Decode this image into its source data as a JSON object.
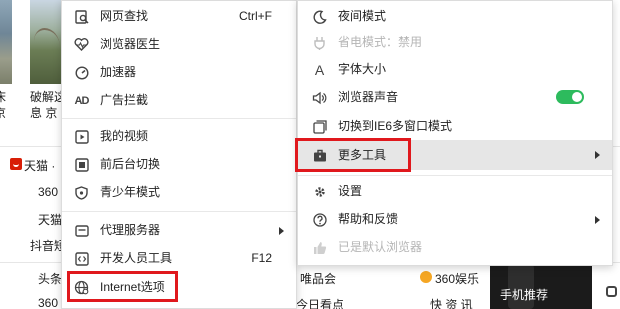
{
  "background": {
    "snippets": [
      {
        "text": "破解这"
      },
      {
        "text": "息 京"
      },
      {
        "text": "天猫 ·"
      },
      {
        "text": "360"
      },
      {
        "text": "天猫"
      },
      {
        "text": "抖音短"
      },
      {
        "text": "头条"
      },
      {
        "text": "360"
      },
      {
        "text": "唯品会"
      },
      {
        "text": "360娱乐"
      },
      {
        "text": "今日看点"
      },
      {
        "text": "快 资 讯"
      },
      {
        "text": "手机推荐"
      },
      {
        "text": "床"
      },
      {
        "text": "京"
      }
    ]
  },
  "left_menu": {
    "items": [
      {
        "label": "网页查找",
        "shortcut": "Ctrl+F",
        "icon": "find-page-icon"
      },
      {
        "label": "浏览器医生",
        "icon": "doctor-heart-icon"
      },
      {
        "label": "加速器",
        "icon": "speedometer-icon"
      },
      {
        "label": "广告拦截",
        "icon": "ad-block-icon"
      },
      {
        "label": "我的视频",
        "icon": "video-play-icon"
      },
      {
        "label": "前后台切换",
        "icon": "switch-window-icon"
      },
      {
        "label": "青少年模式",
        "icon": "shield-icon"
      },
      {
        "label": "代理服务器",
        "icon": "proxy-icon"
      },
      {
        "label": "开发人员工具",
        "shortcut": "F12",
        "icon": "code-icon"
      },
      {
        "label": "Internet选项",
        "icon": "internet-globe-icon"
      }
    ]
  },
  "right_menu": {
    "items": [
      {
        "label": "夜间模式",
        "icon": "moon-icon"
      },
      {
        "label": "省电模式：禁用",
        "icon": "plug-icon",
        "disabled": true
      },
      {
        "label": "字体大小",
        "icon": "font-size-icon"
      },
      {
        "label": "浏览器声音",
        "icon": "speaker-icon",
        "toggle": "on"
      },
      {
        "label": "切换到IE6多窗口模式",
        "icon": "multi-window-icon"
      },
      {
        "label": "更多工具",
        "icon": "toolbox-icon"
      },
      {
        "label": "设置",
        "icon": "gear-icon"
      },
      {
        "label": "帮助和反馈",
        "icon": "help-icon"
      },
      {
        "label": "已是默认浏览器",
        "icon": "thumbs-up-icon",
        "disabled": true
      }
    ]
  },
  "colors": {
    "highlight_border": "#e0181d",
    "toggle_on": "#2dbb5d",
    "hover_bg": "#e6e6e6"
  }
}
